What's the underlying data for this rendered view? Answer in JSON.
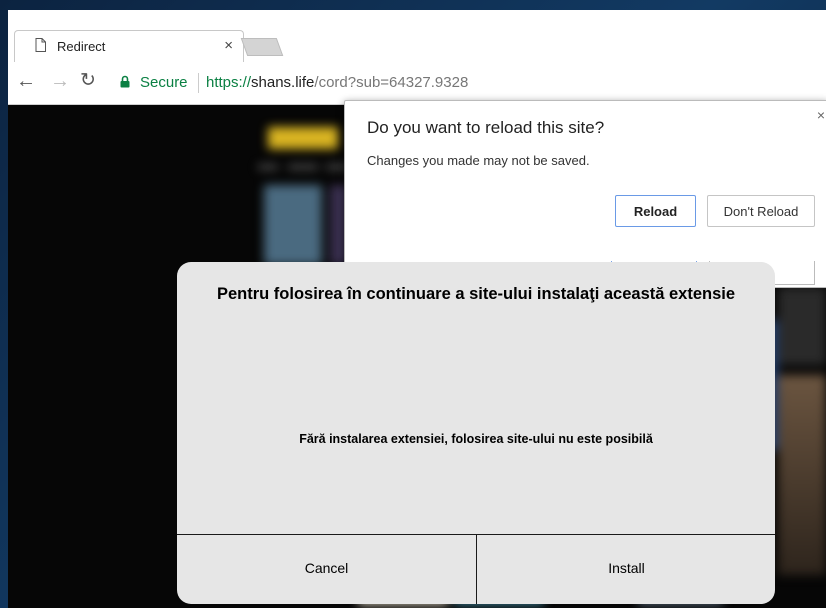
{
  "browser": {
    "tab": {
      "title": "Redirect",
      "close_glyph": "×"
    },
    "toolbar": {
      "back_glyph": "←",
      "forward_glyph": "→",
      "reload_glyph": "↻",
      "security_label": "Secure",
      "url_scheme": "https://",
      "url_host": "shans.life",
      "url_path": "/cord?sub=64327.9328"
    }
  },
  "reload_dialog": {
    "title": "Do you want to reload this site?",
    "message": "Changes you made may not be saved.",
    "close_glyph": "×",
    "reload_label": "Reload",
    "dont_reload_label": "Don't Reload"
  },
  "extension_modal": {
    "title": "Pentru folosirea în continuare a site-ului instalaţi această extensie",
    "message": "Fără instalarea extensiei, folosirea site-ului nu este posibilă",
    "cancel_label": "Cancel",
    "install_label": "Install"
  },
  "colors": {
    "secure_green": "#0b8043",
    "page_background": "#060606",
    "modal_background": "#e6e6e6",
    "primary_button_border": "#6a9ae6"
  },
  "icons": [
    "page-icon",
    "close-icon",
    "back-arrow-icon",
    "forward-arrow-icon",
    "reload-icon",
    "lock-icon"
  ]
}
